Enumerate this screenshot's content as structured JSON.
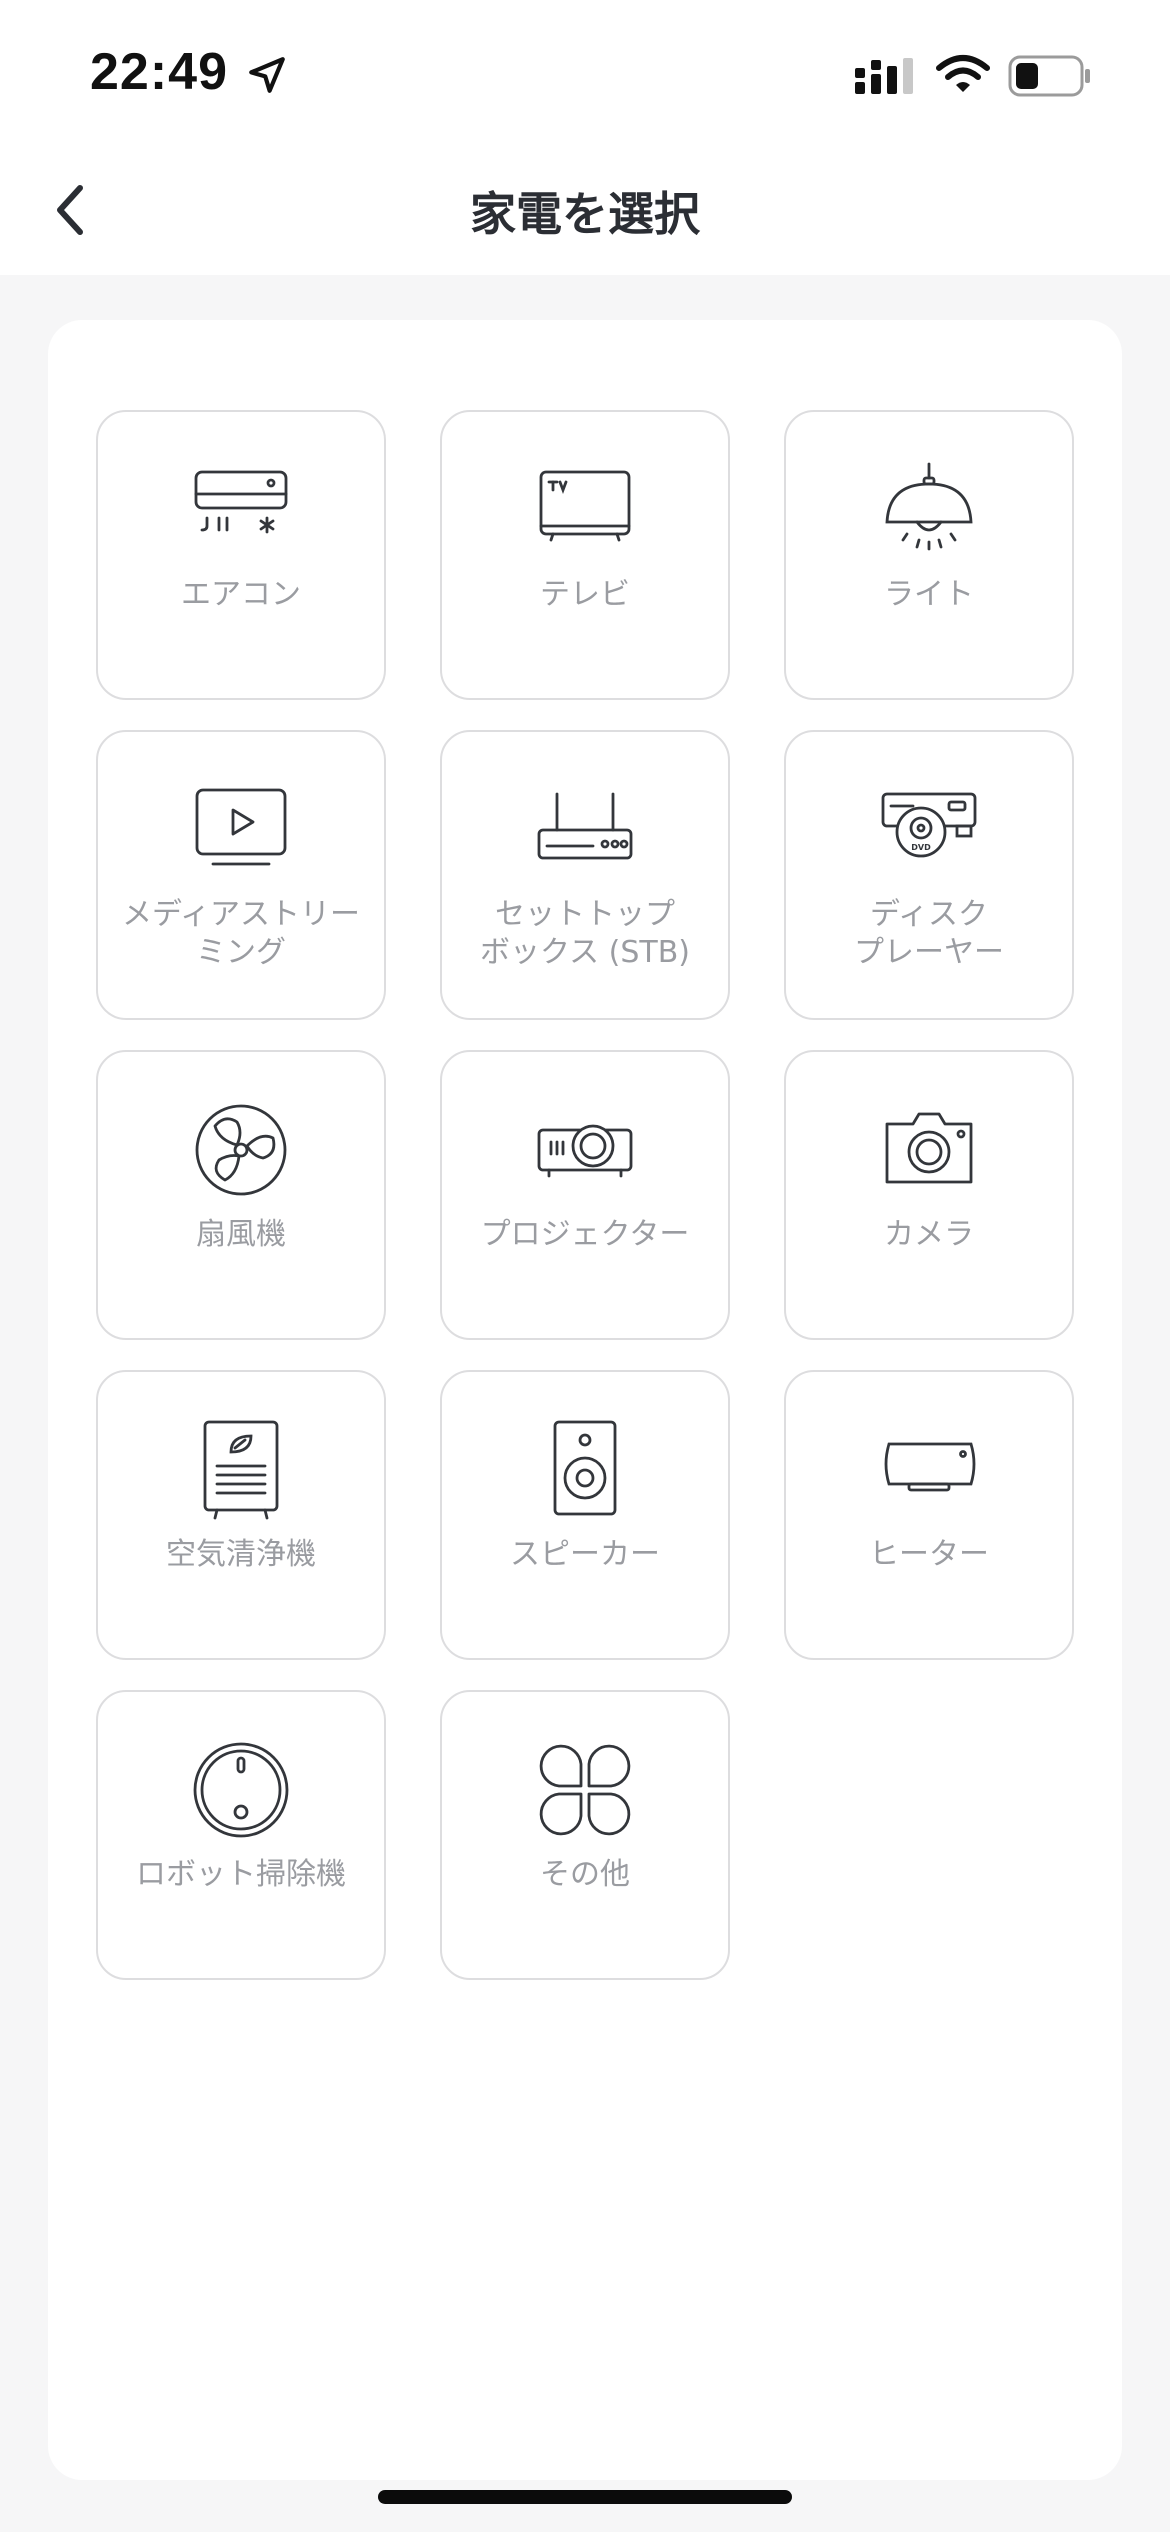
{
  "status_bar": {
    "time": "22:49",
    "icons": [
      "location-arrow-icon",
      "cellular-signal-icon",
      "wifi-icon",
      "battery-icon"
    ]
  },
  "nav": {
    "title": "家電を選択",
    "back_icon": "chevron-left-icon"
  },
  "appliances": [
    {
      "label": "エアコン",
      "icon": "air-conditioner-icon"
    },
    {
      "label": "テレビ",
      "icon": "tv-icon"
    },
    {
      "label": "ライト",
      "icon": "light-icon"
    },
    {
      "label": "メディアストリー\nミング",
      "icon": "media-streaming-icon"
    },
    {
      "label": "セットトップ\nボックス (STB)",
      "icon": "set-top-box-icon"
    },
    {
      "label": "ディスク\nプレーヤー",
      "icon": "disc-player-icon"
    },
    {
      "label": "扇風機",
      "icon": "fan-icon"
    },
    {
      "label": "プロジェクター",
      "icon": "projector-icon"
    },
    {
      "label": "カメラ",
      "icon": "camera-icon"
    },
    {
      "label": "空気清浄機",
      "icon": "air-purifier-icon"
    },
    {
      "label": "スピーカー",
      "icon": "speaker-icon"
    },
    {
      "label": "ヒーター",
      "icon": "heater-icon"
    },
    {
      "label": "ロボット掃除機",
      "icon": "robot-vacuum-icon"
    },
    {
      "label": "その他",
      "icon": "other-icon"
    }
  ]
}
